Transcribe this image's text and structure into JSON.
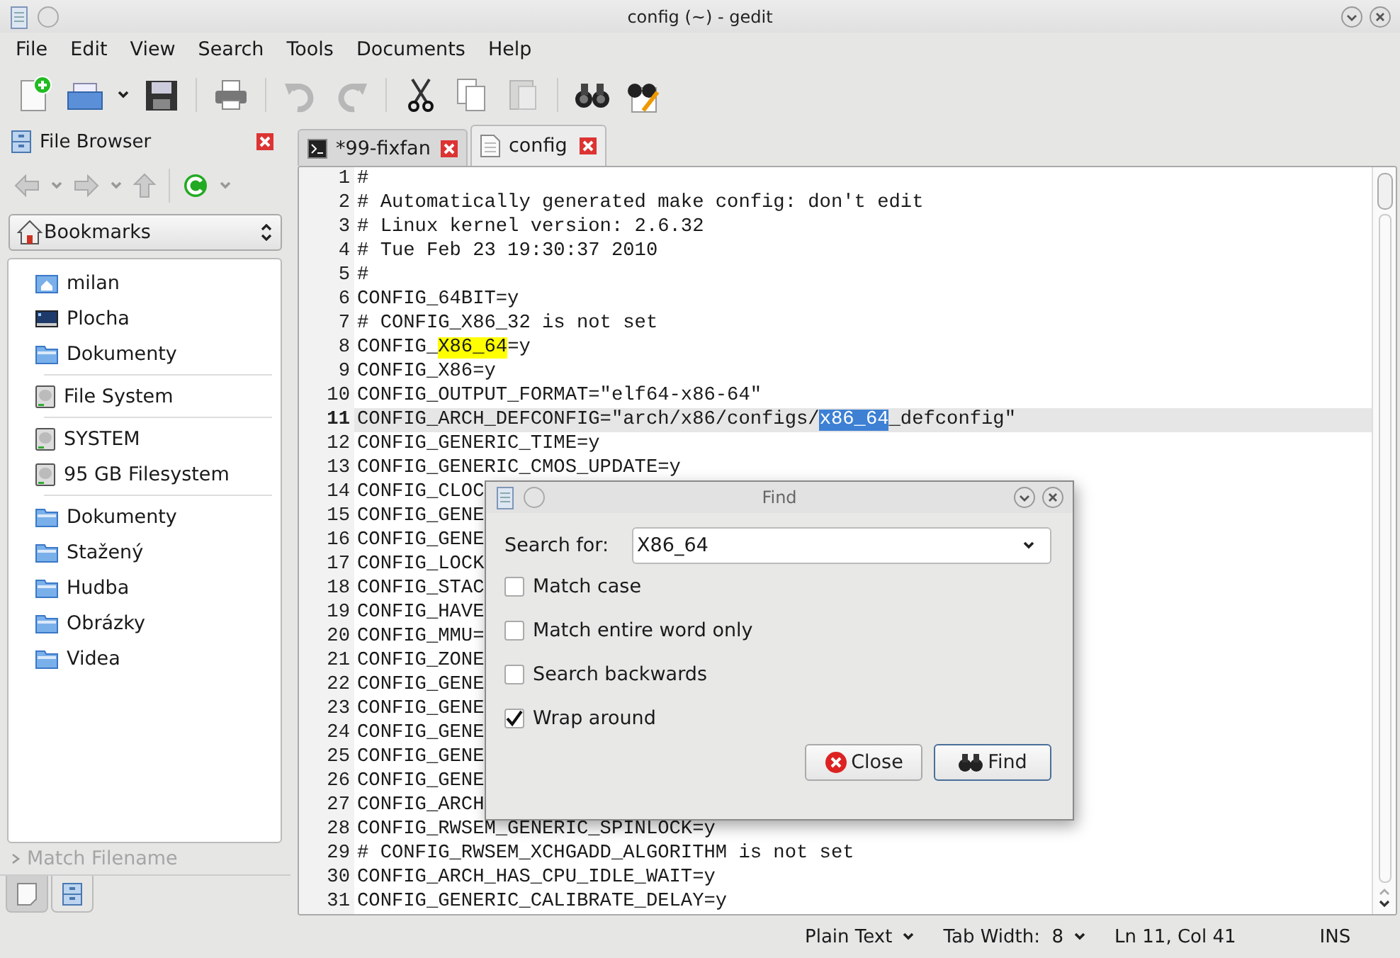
{
  "window": {
    "title": "config (~) - gedit"
  },
  "menu": [
    "File",
    "Edit",
    "View",
    "Search",
    "Tools",
    "Documents",
    "Help"
  ],
  "toolbar": [
    {
      "kind": "new",
      "disabled": false
    },
    {
      "kind": "open",
      "disabled": false
    },
    {
      "kind": "save",
      "disabled": false
    },
    {
      "kind": "print",
      "disabled": false
    },
    {
      "kind": "undo",
      "disabled": true
    },
    {
      "kind": "redo",
      "disabled": true
    },
    {
      "kind": "cut",
      "disabled": false
    },
    {
      "kind": "copy",
      "disabled": false
    },
    {
      "kind": "paste",
      "disabled": true
    },
    {
      "kind": "find",
      "disabled": false
    },
    {
      "kind": "replace",
      "disabled": false
    }
  ],
  "side_panel": {
    "title": "File Browser",
    "location": "Bookmarks",
    "bookmark_groups": [
      {
        "items": [
          {
            "label": "milan",
            "kind": "home"
          },
          {
            "label": "Plocha",
            "kind": "desktop"
          },
          {
            "label": "Dokumenty",
            "kind": "folder"
          }
        ]
      },
      {
        "items": [
          {
            "label": "File System",
            "kind": "drive"
          }
        ]
      },
      {
        "items": [
          {
            "label": "SYSTEM",
            "kind": "drive"
          },
          {
            "label": "95 GB Filesystem",
            "kind": "drive"
          }
        ]
      },
      {
        "items": [
          {
            "label": "Dokumenty",
            "kind": "folder"
          },
          {
            "label": "Stažený",
            "kind": "folder"
          },
          {
            "label": "Hudba",
            "kind": "folder"
          },
          {
            "label": "Obrázky",
            "kind": "folder"
          },
          {
            "label": "Videa",
            "kind": "folder"
          }
        ]
      }
    ],
    "filter": {
      "label": "Match Filename",
      "expanded": false
    },
    "panel_tabs": [
      {
        "kind": "documents",
        "selected": true
      },
      {
        "kind": "file-browser",
        "selected": false
      }
    ]
  },
  "tabs": [
    {
      "label": "*99-fixfan",
      "kind": "terminal",
      "selected": false
    },
    {
      "label": "config",
      "kind": "document",
      "selected": true
    }
  ],
  "editor": {
    "lines": [
      {
        "number": "1",
        "current": false,
        "segments": [
          {
            "text": "#"
          }
        ]
      },
      {
        "number": "2",
        "current": false,
        "segments": [
          {
            "text": "# Automatically generated make config: don't edit"
          }
        ]
      },
      {
        "number": "3",
        "current": false,
        "segments": [
          {
            "text": "# Linux kernel version: 2.6.32"
          }
        ]
      },
      {
        "number": "4",
        "current": false,
        "segments": [
          {
            "text": "# Tue Feb 23 19:30:37 2010"
          }
        ]
      },
      {
        "number": "5",
        "current": false,
        "segments": [
          {
            "text": "#"
          }
        ]
      },
      {
        "number": "6",
        "current": false,
        "segments": [
          {
            "text": "CONFIG_64BIT=y"
          }
        ]
      },
      {
        "number": "7",
        "current": false,
        "segments": [
          {
            "text": "# CONFIG_X86_32 is not set"
          }
        ]
      },
      {
        "number": "8",
        "current": false,
        "segments": [
          {
            "text": "CONFIG_"
          },
          {
            "text": "X86_64",
            "kind": "match"
          },
          {
            "text": "=y"
          }
        ]
      },
      {
        "number": "9",
        "current": false,
        "segments": [
          {
            "text": "CONFIG_X86=y"
          }
        ]
      },
      {
        "number": "10",
        "current": false,
        "segments": [
          {
            "text": "CONFIG_OUTPUT_FORMAT=\"elf64-x86-64\""
          }
        ]
      },
      {
        "number": "11",
        "current": true,
        "segments": [
          {
            "text": "CONFIG_ARCH_DEFCONFIG=\"arch/x86/configs/"
          },
          {
            "text": "x86_64",
            "kind": "selection"
          },
          {
            "text": "_defconfig\""
          }
        ]
      },
      {
        "number": "12",
        "current": false,
        "segments": [
          {
            "text": "CONFIG_GENERIC_TIME=y"
          }
        ]
      },
      {
        "number": "13",
        "current": false,
        "segments": [
          {
            "text": "CONFIG_GENERIC_CMOS_UPDATE=y"
          }
        ]
      },
      {
        "number": "14",
        "current": false,
        "segments": [
          {
            "text": "CONFIG_CLOC"
          }
        ]
      },
      {
        "number": "15",
        "current": false,
        "segments": [
          {
            "text": "CONFIG_GENE"
          }
        ]
      },
      {
        "number": "16",
        "current": false,
        "segments": [
          {
            "text": "CONFIG_GENE"
          }
        ]
      },
      {
        "number": "17",
        "current": false,
        "segments": [
          {
            "text": "CONFIG_LOCK"
          }
        ]
      },
      {
        "number": "18",
        "current": false,
        "segments": [
          {
            "text": "CONFIG_STAC"
          }
        ]
      },
      {
        "number": "19",
        "current": false,
        "segments": [
          {
            "text": "CONFIG_HAVE"
          }
        ]
      },
      {
        "number": "20",
        "current": false,
        "segments": [
          {
            "text": "CONFIG_MMU="
          }
        ]
      },
      {
        "number": "21",
        "current": false,
        "segments": [
          {
            "text": "CONFIG_ZONE"
          }
        ]
      },
      {
        "number": "22",
        "current": false,
        "segments": [
          {
            "text": "CONFIG_GENE"
          }
        ]
      },
      {
        "number": "23",
        "current": false,
        "segments": [
          {
            "text": "CONFIG_GENE"
          }
        ]
      },
      {
        "number": "24",
        "current": false,
        "segments": [
          {
            "text": "CONFIG_GENE"
          }
        ]
      },
      {
        "number": "25",
        "current": false,
        "segments": [
          {
            "text": "CONFIG_GENE"
          }
        ]
      },
      {
        "number": "26",
        "current": false,
        "segments": [
          {
            "text": "CONFIG_GENE"
          }
        ]
      },
      {
        "number": "27",
        "current": false,
        "segments": [
          {
            "text": "CONFIG_ARCH"
          }
        ]
      },
      {
        "number": "28",
        "current": false,
        "segments": [
          {
            "text": "CONFIG_RWSEM_GENERIC_SPINLOCK=y"
          }
        ]
      },
      {
        "number": "29",
        "current": false,
        "segments": [
          {
            "text": "# CONFIG_RWSEM_XCHGADD_ALGORITHM is not set"
          }
        ]
      },
      {
        "number": "30",
        "current": false,
        "segments": [
          {
            "text": "CONFIG_ARCH_HAS_CPU_IDLE_WAIT=y"
          }
        ]
      },
      {
        "number": "31",
        "current": false,
        "segments": [
          {
            "text": "CONFIG_GENERIC_CALIBRATE_DELAY=y"
          }
        ]
      }
    ]
  },
  "find_dialog": {
    "title": "Find",
    "search_label": "Search for:",
    "search_value": "X86_64",
    "options": [
      {
        "label": "Match case",
        "checked": false
      },
      {
        "label": "Match entire word only",
        "checked": false
      },
      {
        "label": "Search backwards",
        "checked": false
      },
      {
        "label": "Wrap around",
        "checked": true
      }
    ],
    "buttons": [
      {
        "label": "Close",
        "kind": "close"
      },
      {
        "label": "Find",
        "kind": "find"
      }
    ]
  },
  "status_bar": {
    "language": "Plain Text",
    "tab_width": "Tab Width:  8",
    "position": "Ln 11, Col 41",
    "mode": "INS"
  }
}
